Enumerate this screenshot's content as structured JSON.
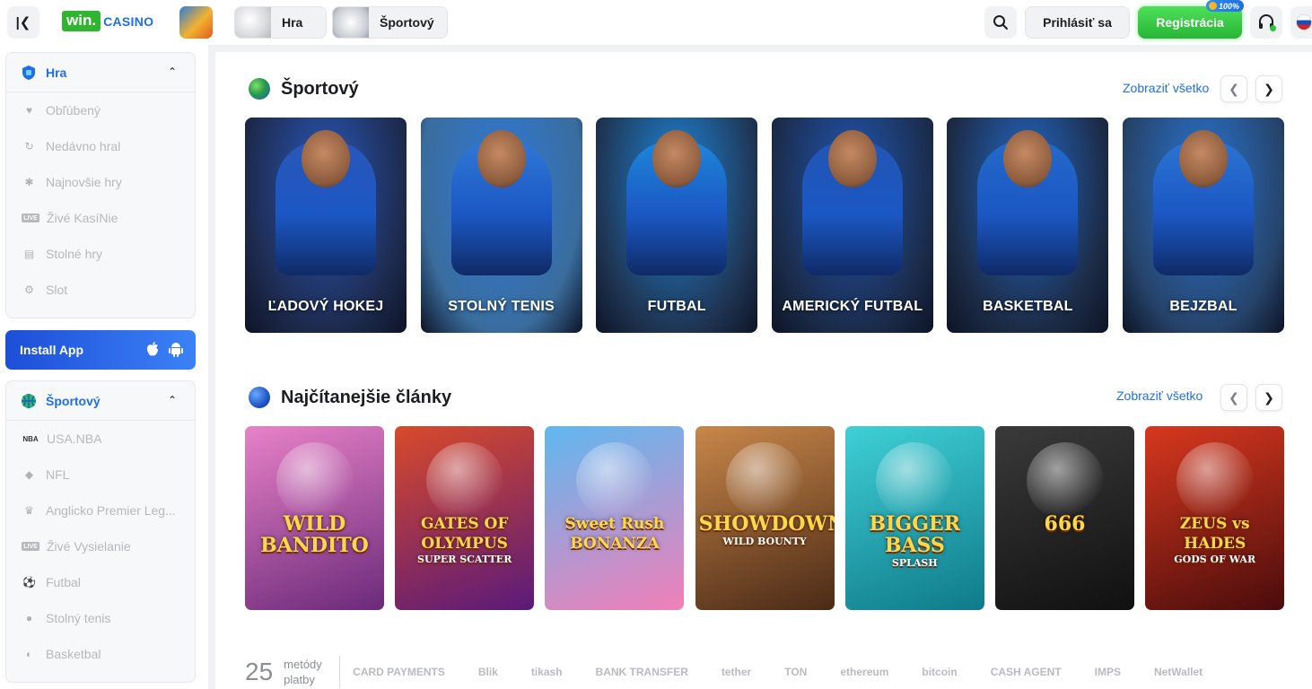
{
  "header": {
    "logo_win": "win.",
    "logo_casino": "CASINO",
    "nav_hra": "Hra",
    "nav_sport": "Športový",
    "login": "Prihlásiť sa",
    "register": "Registrácia",
    "register_badge": "100%"
  },
  "sidebar": {
    "games_title": "Hra",
    "games_items": [
      {
        "label": "Obľúbený",
        "icon": "heart-icon"
      },
      {
        "label": "Nedávno hral",
        "icon": "history-icon"
      },
      {
        "label": "Najnovšie hry",
        "icon": "new-icon"
      },
      {
        "label": "Živé KasíNie",
        "icon": "live-icon"
      },
      {
        "label": "Stolné hry",
        "icon": "cards-icon"
      },
      {
        "label": "Slot",
        "icon": "gear-icon"
      }
    ],
    "install_app": "Install App",
    "sport_title": "Športový",
    "sport_items": [
      {
        "label": "USA.NBA",
        "icon": "nba-icon"
      },
      {
        "label": "NFL",
        "icon": "nfl-icon"
      },
      {
        "label": "Anglicko Premier Leg...",
        "icon": "premier-league-icon"
      },
      {
        "label": "Živé Vysielanie",
        "icon": "live-icon"
      },
      {
        "label": "Futbal",
        "icon": "soccer-ball-icon"
      },
      {
        "label": "Stolný tenis",
        "icon": "table-tennis-icon"
      },
      {
        "label": "Basketbal",
        "icon": "basketball-icon"
      }
    ]
  },
  "sports_section": {
    "title": "Športový",
    "see_all": "Zobraziť všetko",
    "cards": [
      {
        "label": "ĽADOVÝ HOKEJ",
        "bg": "#1d2a4d",
        "accent": "#2a57b8"
      },
      {
        "label": "STOLNÝ TENIS",
        "bg": "#3a6d9e",
        "accent": "#2f78d6"
      },
      {
        "label": "FUTBAL",
        "bg": "#1f3553",
        "accent": "#1e86d9"
      },
      {
        "label": "AMERICKÝ FUTBAL",
        "bg": "#1b2c4b",
        "accent": "#2156b3"
      },
      {
        "label": "BASKETBAL",
        "bg": "#1c2b45",
        "accent": "#2469c9"
      },
      {
        "label": "BEJZBAL",
        "bg": "#26446b",
        "accent": "#2a74d2"
      }
    ]
  },
  "articles_section": {
    "title": "Najčítanejšie články",
    "see_all": "Zobraziť všetko",
    "games": [
      {
        "title": "WILD BANDITO",
        "subtitle": "",
        "bg1": "#e882c8",
        "bg2": "#6b2a7a"
      },
      {
        "title": "GATES OF OLYMPUS",
        "subtitle": "SUPER SCATTER",
        "bg1": "#d84a2a",
        "bg2": "#5a1a7a"
      },
      {
        "title": "Sweet Rush BONANZA",
        "subtitle": "",
        "bg1": "#5fb8f0",
        "bg2": "#f27fb8"
      },
      {
        "title": "SHOWDOWN",
        "subtitle": "WILD BOUNTY",
        "bg1": "#c9874a",
        "bg2": "#4a2a16"
      },
      {
        "title": "BIGGER BASS",
        "subtitle": "SPLASH",
        "bg1": "#3fd0d6",
        "bg2": "#0f7a8a"
      },
      {
        "title": "666",
        "subtitle": "",
        "bg1": "#3a3a3a",
        "bg2": "#101010"
      },
      {
        "title": "ZEUS vs HADES",
        "subtitle": "GODS OF WAR",
        "bg1": "#d8381e",
        "bg2": "#4a0c0c"
      }
    ]
  },
  "payments": {
    "count": "25",
    "label": "metódy platby",
    "methods": [
      "CARD PAYMENTS",
      "Blik",
      "tikash",
      "BANK TRANSFER",
      "tether",
      "TON",
      "ethereum",
      "bitcoin",
      "CASH AGENT",
      "IMPS",
      "NetWallet"
    ]
  }
}
